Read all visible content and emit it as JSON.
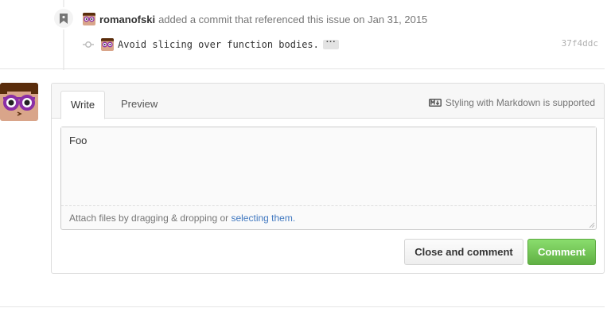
{
  "timeline": {
    "event": {
      "author": "romanofski",
      "text": "added a commit that referenced this issue on Jan 31, 2015"
    },
    "commit": {
      "message": "Avoid slicing over function bodies.",
      "more_label": "···",
      "sha": "37f4ddc"
    }
  },
  "comment_form": {
    "tabs": [
      {
        "label": "Write",
        "selected": true
      },
      {
        "label": "Preview",
        "selected": false
      }
    ],
    "markdown_note": "Styling with Markdown is supported",
    "textarea_value": "Foo",
    "attach_text": "Attach files by dragging & dropping or ",
    "attach_link": "selecting them.",
    "close_button_label": "Close and comment",
    "comment_button_label": "Comment"
  },
  "colors": {
    "accent_green": "#6cc644",
    "link_blue": "#4078c0",
    "avatar_purple": "#8b2fa6",
    "avatar_skin": "#d9a58a"
  },
  "icons": [
    "bookmark-icon",
    "git-commit-icon",
    "markdown-icon",
    "avatar-icon"
  ]
}
